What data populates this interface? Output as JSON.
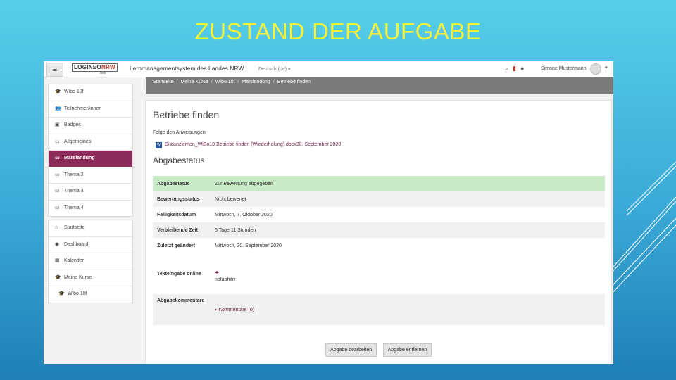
{
  "slide": {
    "title": "ZUSTAND DER AUFGABE"
  },
  "navbar": {
    "menu_icon": "hamburger-icon",
    "logo_main": "LOGINEO",
    "logo_nrw": "NRW",
    "logo_sub": "LMS",
    "site_name": "Lernmanagementsystem des Landes NRW",
    "language": "Deutsch (de) ▾",
    "user_name": "Simone Mustermann",
    "user_caret": "▾"
  },
  "breadcrumb": [
    "Startseite",
    "Meine Kurse",
    "Wibo 10f",
    "Marslandung",
    "Betriebe finden"
  ],
  "breadcrumb_separator": "/",
  "sidebar": {
    "course_items": [
      {
        "icon": "graduation-cap-icon",
        "glyph": "🎓",
        "label": "Wibo 10f"
      },
      {
        "icon": "users-icon",
        "glyph": "👥",
        "label": "Teilnehmer/innen"
      },
      {
        "icon": "badge-icon",
        "glyph": "▣",
        "label": "Badges"
      },
      {
        "icon": "folder-icon",
        "glyph": "▭",
        "label": "Allgemeines"
      },
      {
        "icon": "folder-icon",
        "glyph": "▭",
        "label": "Marslandung",
        "active": true
      },
      {
        "icon": "folder-icon",
        "glyph": "▭",
        "label": "Thema 2"
      },
      {
        "icon": "folder-icon",
        "glyph": "▭",
        "label": "Thema 3"
      },
      {
        "icon": "folder-icon",
        "glyph": "▭",
        "label": "Thema 4"
      }
    ],
    "site_items": [
      {
        "icon": "home-icon",
        "glyph": "⌂",
        "label": "Startseite"
      },
      {
        "icon": "dashboard-icon",
        "glyph": "◉",
        "label": "Dashboard"
      },
      {
        "icon": "calendar-icon",
        "glyph": "▦",
        "label": "Kalender"
      },
      {
        "icon": "graduation-cap-icon",
        "glyph": "🎓",
        "label": "Meine Kurse"
      },
      {
        "icon": "graduation-cap-icon",
        "glyph": "🎓",
        "label": "Wibo 10f",
        "indent": true
      }
    ]
  },
  "main": {
    "title": "Betriebe finden",
    "instructions": "Folge den Anweisungen",
    "file_link": "Distanzlernen_WiBo10 Betriebe finden (Wiederholung).docx",
    "file_date": "30. September 2020",
    "section_title": "Abgabestatus",
    "status_rows": [
      {
        "label": "Abgabestatus",
        "value": "Zur Bewertung abgegeben",
        "style": "sum"
      },
      {
        "label": "Bewertungsstatus",
        "value": "Nicht bewertet",
        "style": "g"
      },
      {
        "label": "Fälligkeitsdatum",
        "value": "Mittwoch, 7. Oktober 2020",
        "style": "w"
      },
      {
        "label": "Verbleibende Zeit",
        "value": "6 Tage 11 Stunden",
        "style": "g"
      },
      {
        "label": "Zuletzt geändert",
        "value": "Mittwoch, 30. September 2020",
        "style": "w"
      }
    ],
    "online_text": {
      "label": "Texteingabe online",
      "plus": "+",
      "value": "nofabhifrr"
    },
    "comments": {
      "label": "Abgabekommentare",
      "value": "Kommentare (0)"
    },
    "buttons": {
      "edit": "Abgabe bearbeiten",
      "remove": "Abgabe entfernen"
    }
  },
  "colors": {
    "accent": "#8b2b5a",
    "submitted_bg": "#c9eac7",
    "title_yellow": "#f5f03a"
  }
}
